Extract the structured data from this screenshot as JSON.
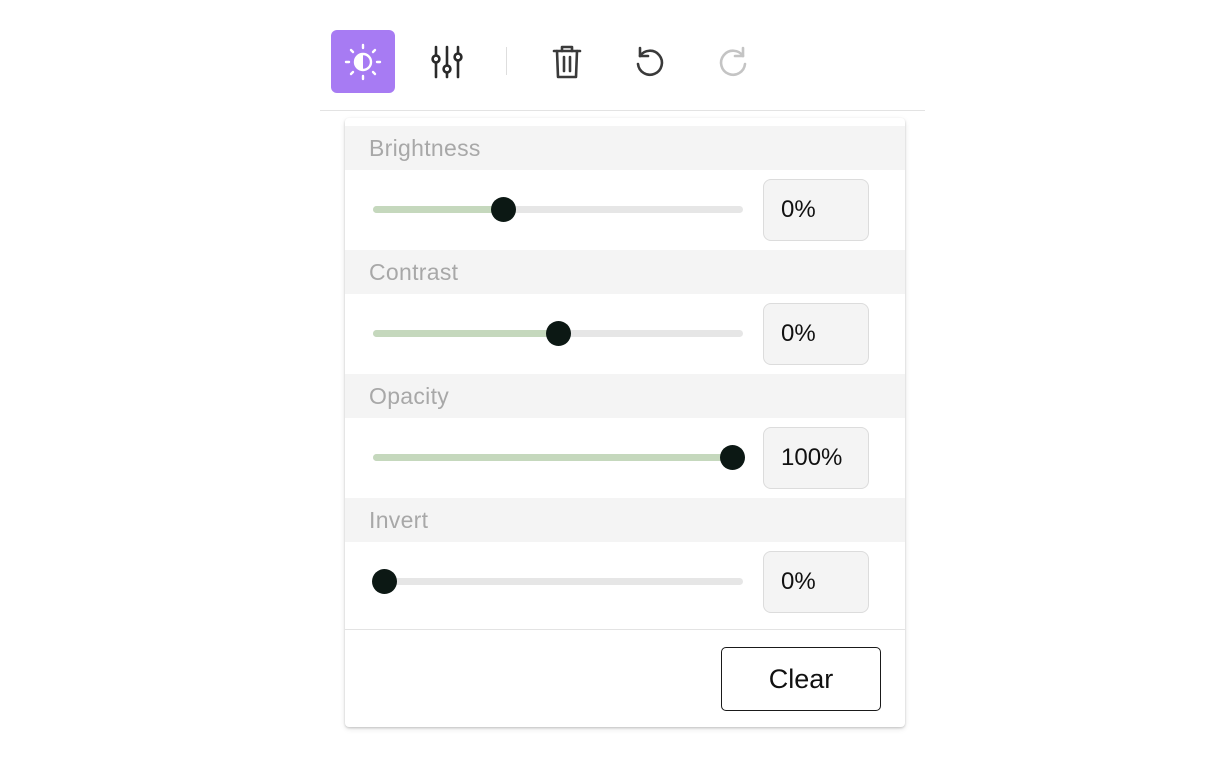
{
  "toolbar": {
    "tools": [
      {
        "icon": "brightness-contrast-icon",
        "active": true
      },
      {
        "icon": "sliders-icon",
        "active": false
      },
      {
        "icon": "trash-icon",
        "active": false
      },
      {
        "icon": "undo-icon",
        "active": false
      },
      {
        "icon": "redo-icon",
        "active": false,
        "disabled": true
      }
    ],
    "active_color": "#a77bf3"
  },
  "panel": {
    "sections": [
      {
        "label": "Brightness",
        "value": "0%",
        "slider_fraction": 0.35
      },
      {
        "label": "Contrast",
        "value": "0%",
        "slider_fraction": 0.5
      },
      {
        "label": "Opacity",
        "value": "100%",
        "slider_fraction": 0.97
      },
      {
        "label": "Invert",
        "value": "0%",
        "slider_fraction": 0.03
      }
    ],
    "clear_label": "Clear"
  },
  "colors": {
    "slider_fill": "#c5d8bd",
    "slider_track": "#e6e6e6",
    "thumb": "#0c1814"
  }
}
